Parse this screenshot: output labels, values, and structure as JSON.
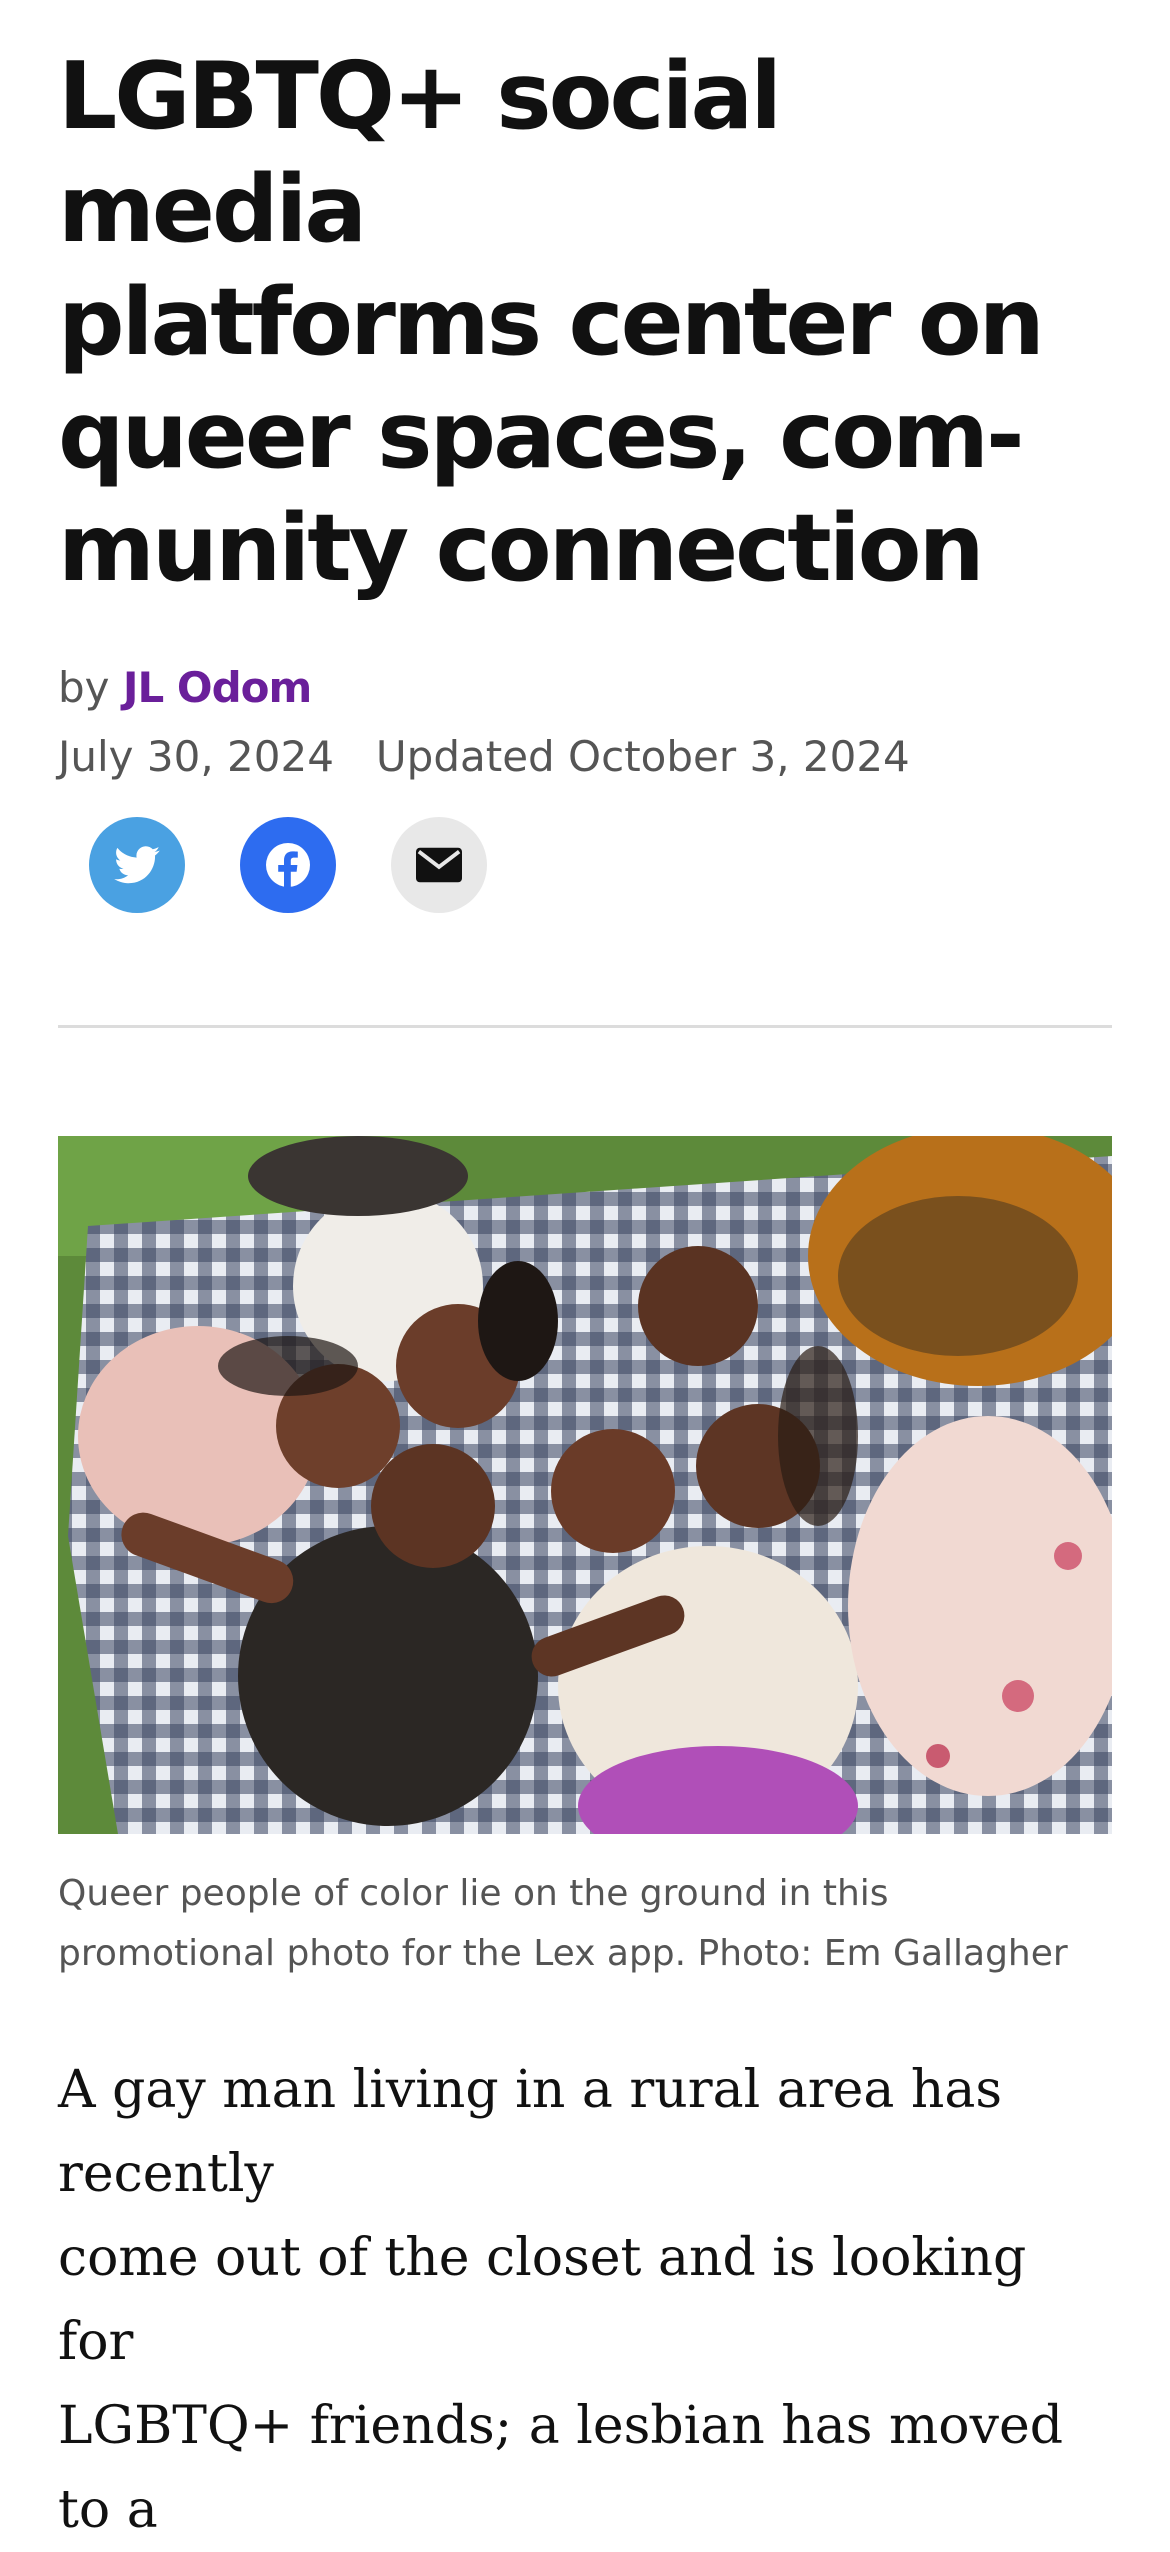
{
  "article": {
    "headline_lines": [
      "LGBTQ+ social media",
      "platforms center on",
      "queer spaces, com-",
      "munity connection"
    ],
    "byline_prefix": "by",
    "author": "JL Odom",
    "published": "July 30, 2024",
    "updated": "Updated October 3, 2024",
    "share_icons": [
      "twitter-icon",
      "facebook-icon",
      "email-icon"
    ],
    "image_caption_lines": [
      "Queer people of color lie on the ground in this",
      "promotional photo for the Lex app. Photo: Em Gallagher"
    ],
    "body_lines": [
      "A gay man living in a rural area has recently",
      "come out of the closet and is looking for",
      "LGBTQ+ friends; a lesbian has moved to a"
    ]
  },
  "colors": {
    "author": "#6a1f9a",
    "twitter": "#4aa1e2",
    "facebook": "#2d6cf0",
    "email": "#e8e8e8"
  }
}
